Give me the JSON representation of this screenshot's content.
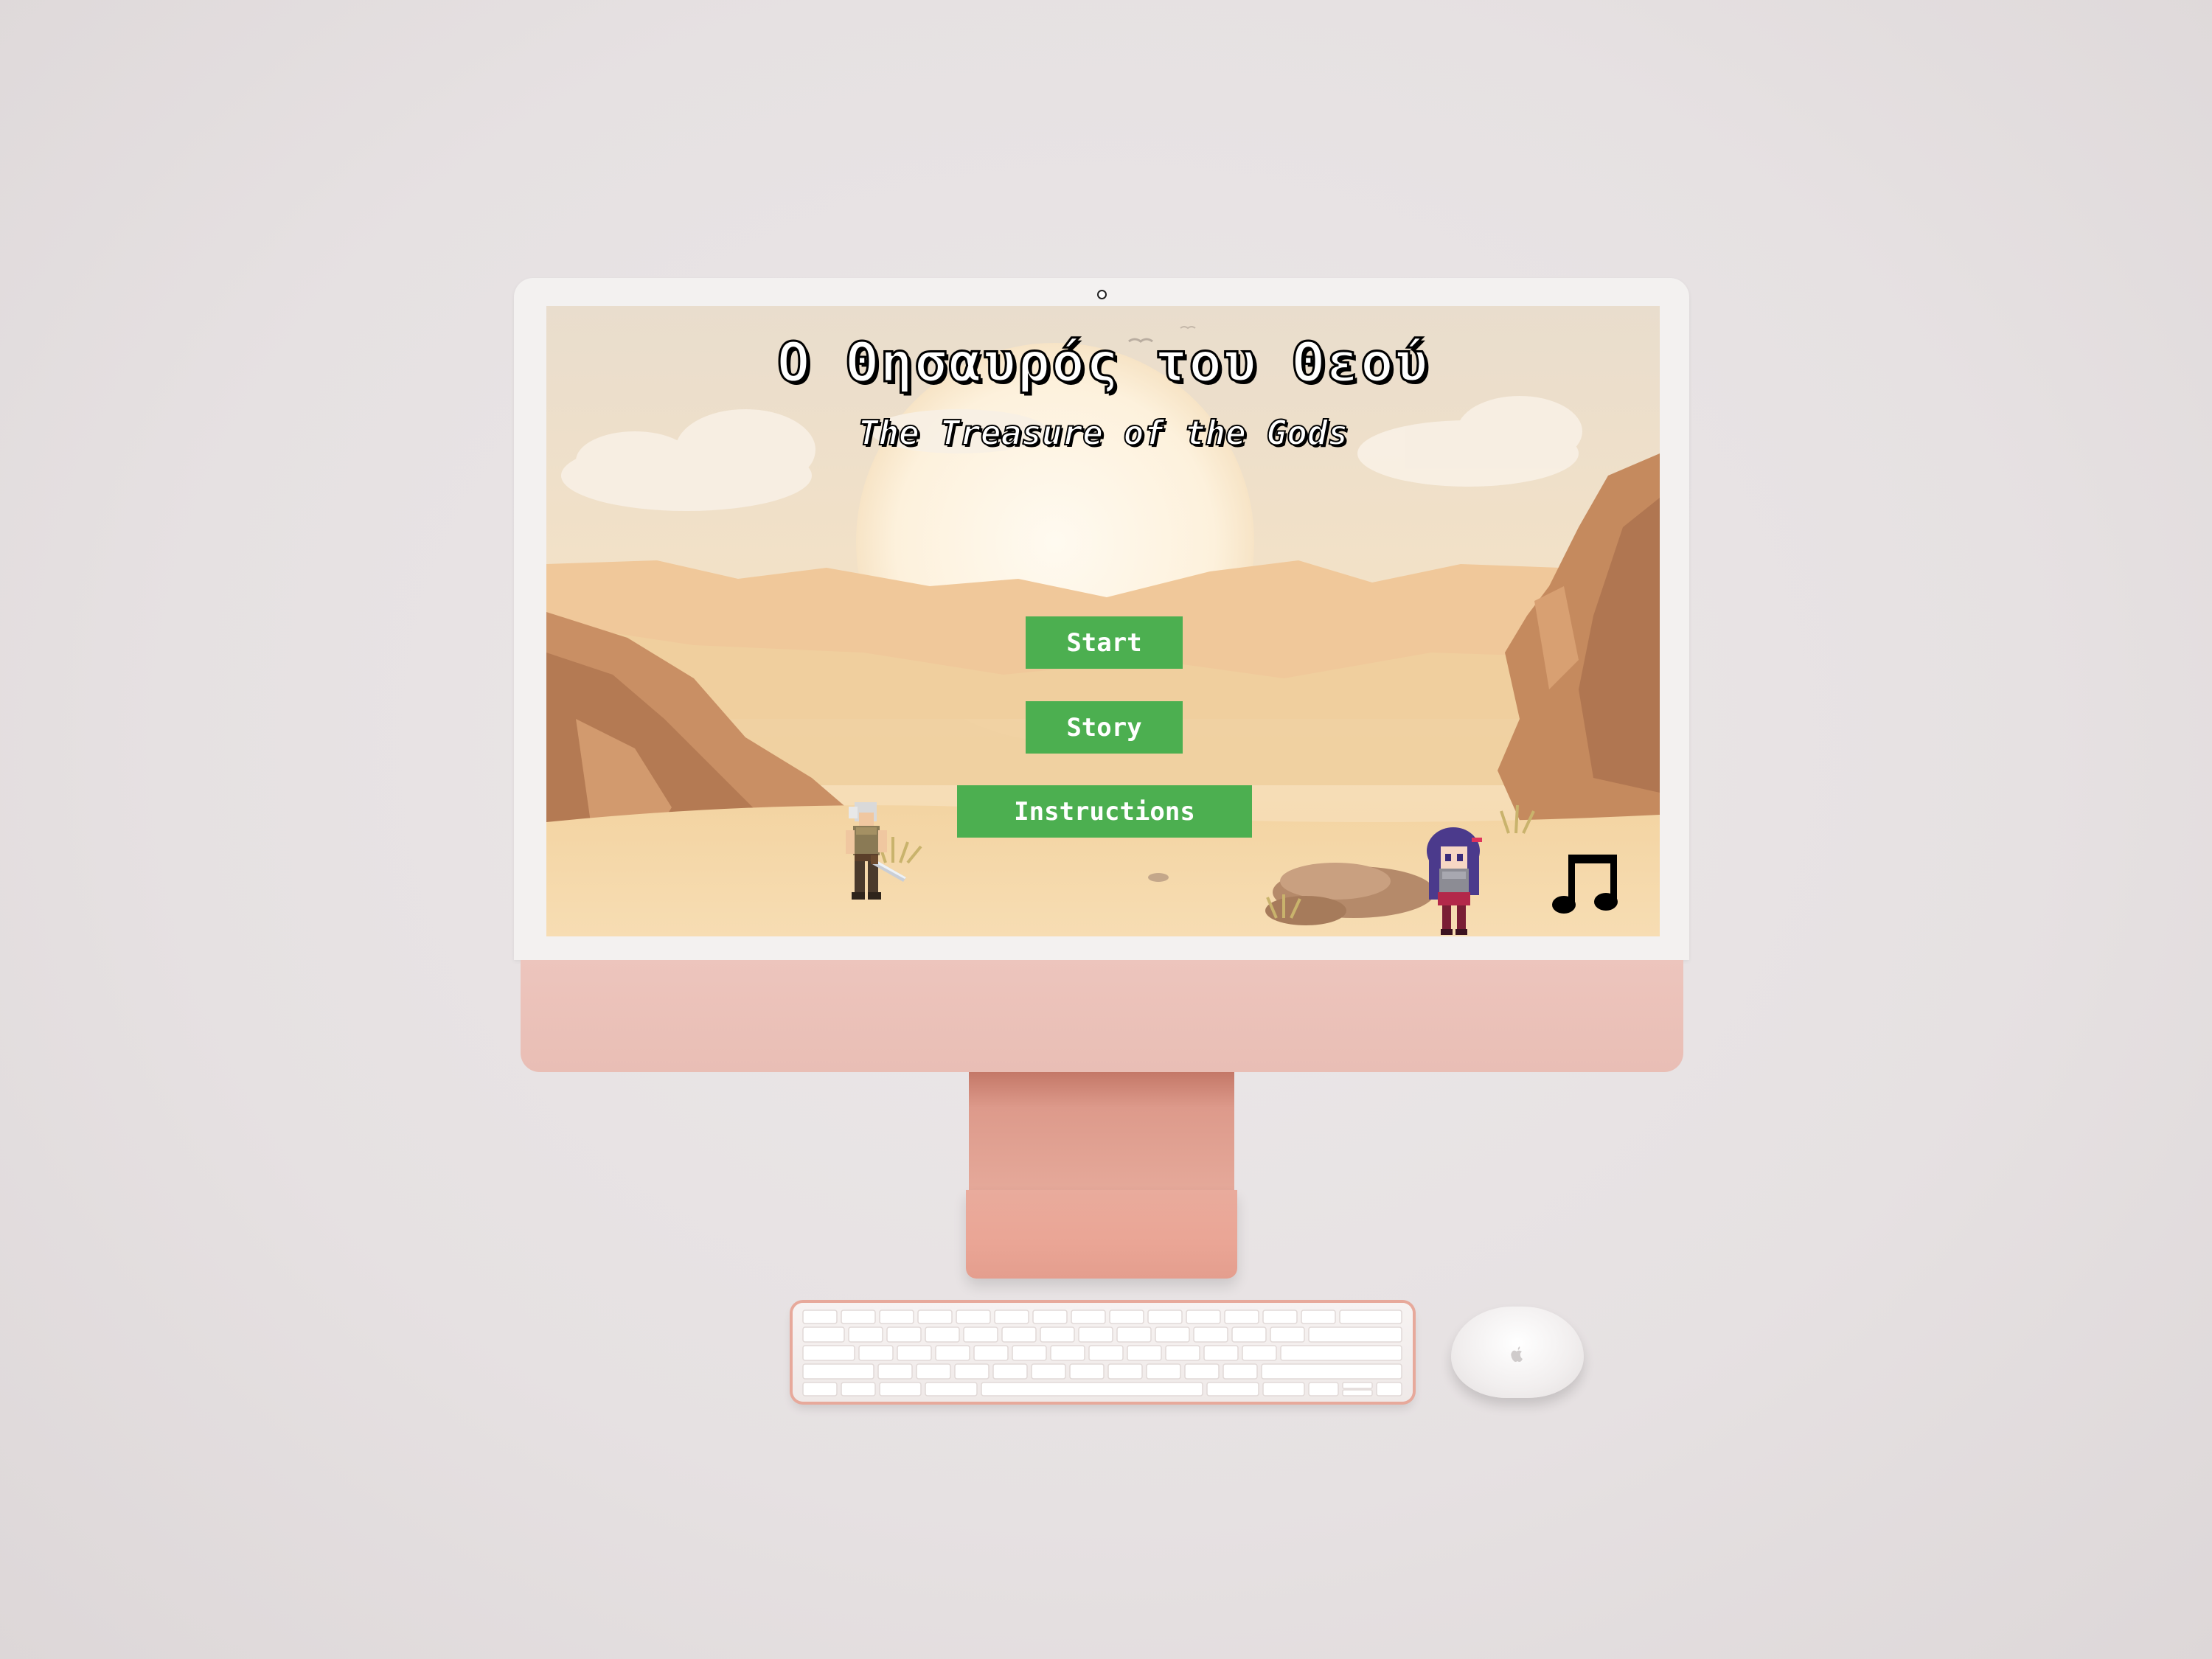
{
  "game": {
    "title": "Ο Θησαυρός του Θεού",
    "subtitle": "The Treasure of the Gods"
  },
  "menu": {
    "start_label": "Start",
    "story_label": "Story",
    "instructions_label": "Instructions"
  },
  "icons": {
    "music": "music-note-icon",
    "camera": "camera-icon",
    "apple_logo": "apple-logo-icon"
  },
  "colors": {
    "button_bg": "#4caf50",
    "button_text": "#ffffff",
    "imac_chin": "#ebc2b9",
    "stand": "#e3a191",
    "sand": "#f1d4a6"
  }
}
